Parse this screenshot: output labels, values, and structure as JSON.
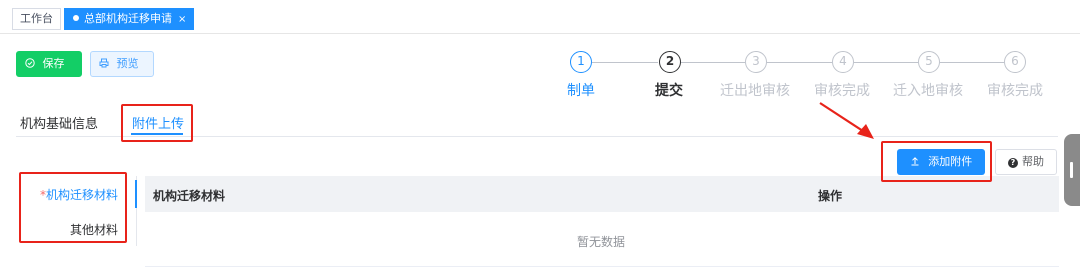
{
  "tabs": {
    "home_label": "工作台",
    "active_label": "总部机构迁移申请",
    "close_glyph": "×"
  },
  "toolbar": {
    "save_label": "保存",
    "preview_label": "预览",
    "save_icon": "check-circle-icon",
    "preview_icon": "printer-icon"
  },
  "steps": [
    {
      "num": "1",
      "label": "制单",
      "state": "done"
    },
    {
      "num": "2",
      "label": "提交",
      "state": "current"
    },
    {
      "num": "3",
      "label": "迁出地审核",
      "state": "pending"
    },
    {
      "num": "4",
      "label": "审核完成",
      "state": "pending"
    },
    {
      "num": "5",
      "label": "迁入地审核",
      "state": "pending"
    },
    {
      "num": "6",
      "label": "审核完成",
      "state": "pending"
    }
  ],
  "section_tabs": {
    "basic_label": "机构基础信息",
    "attach_label": "附件上传",
    "active": "attach"
  },
  "actions": {
    "add_label": "添加附件",
    "add_icon": "upload-icon",
    "help_label": "帮助",
    "help_icon": "question-circle-icon"
  },
  "categories": {
    "required_mark": "*",
    "items": [
      "机构迁移材料",
      "其他材料"
    ]
  },
  "table": {
    "headers": [
      "机构迁移材料",
      "操作"
    ],
    "empty_text": "暂无数据"
  },
  "colors": {
    "primary": "#1e90ff",
    "success": "#13ce66",
    "annotation": "#e8231a"
  }
}
